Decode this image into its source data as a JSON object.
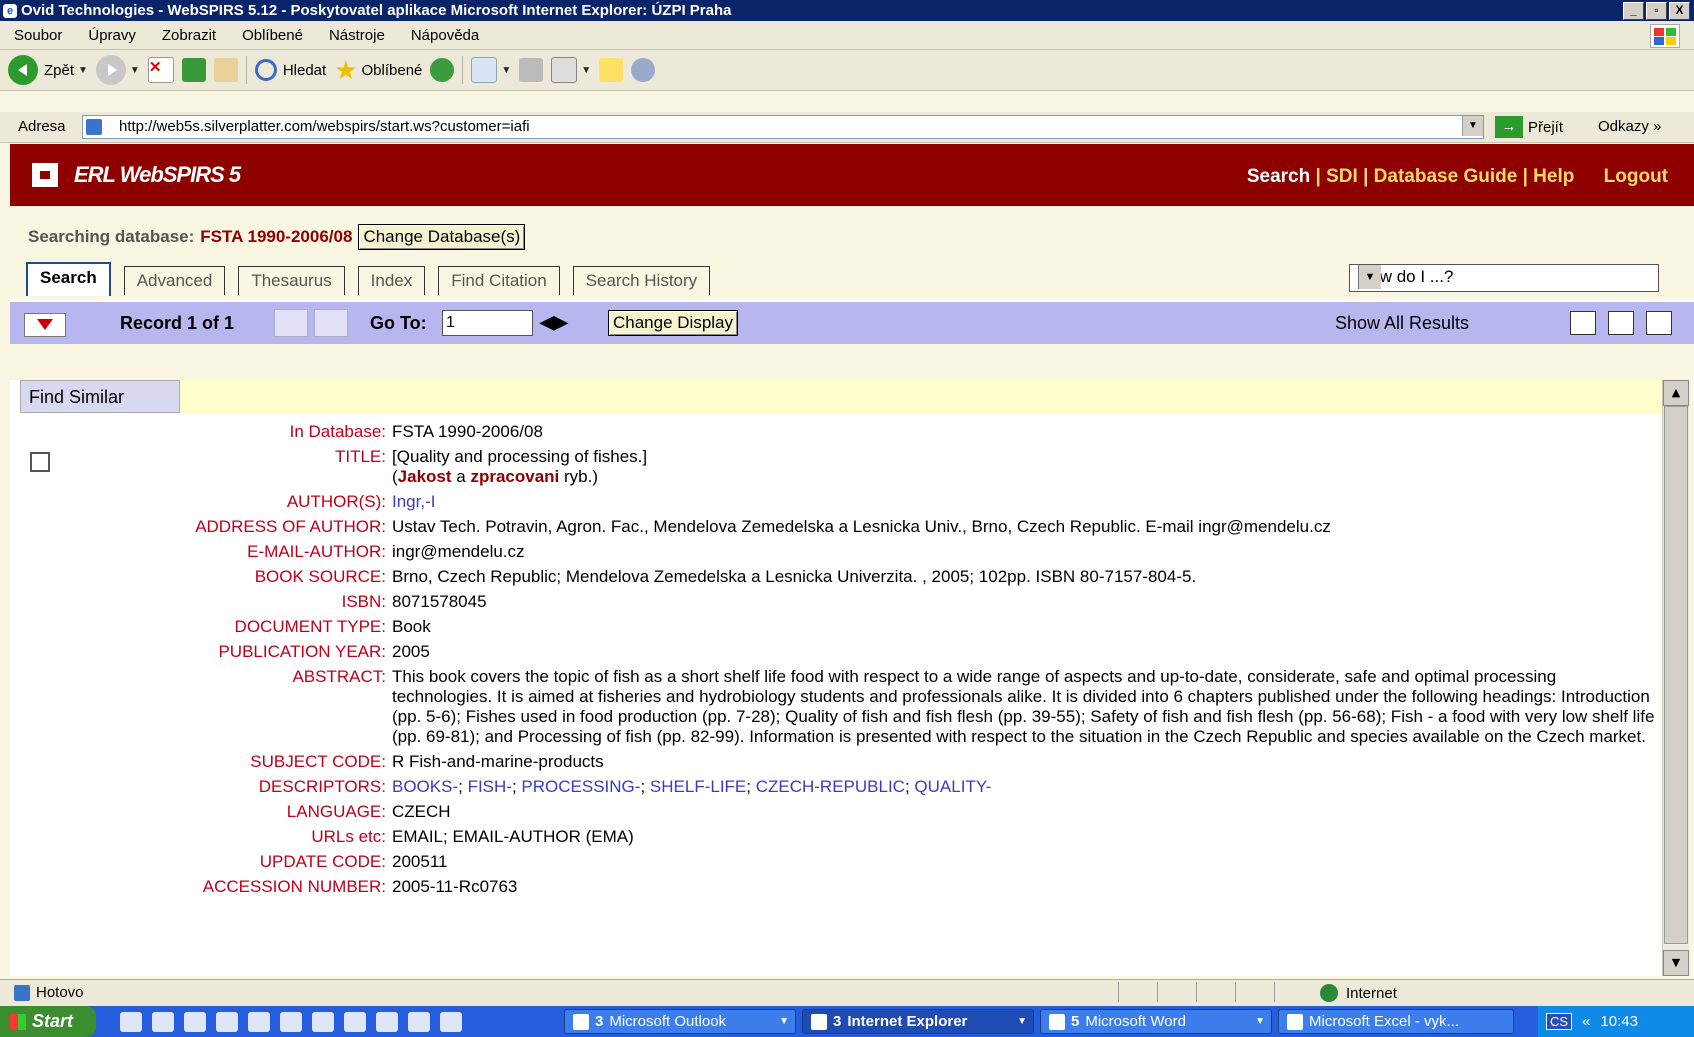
{
  "window": {
    "title": "Ovid Technologies - WebSPIRS 5.12 - Poskytovatel aplikace Microsoft Internet Explorer: ÚZPI Praha",
    "controls": [
      "_",
      "▫",
      "X"
    ]
  },
  "menu": [
    "Soubor",
    "Úpravy",
    "Zobrazit",
    "Oblíbené",
    "Nástroje",
    "Nápověda"
  ],
  "toolbar": {
    "back_label": "Zpět",
    "search_label": "Hledat",
    "favorites_label": "Oblíbené"
  },
  "address": {
    "label": "Adresa",
    "url": "http://web5s.silverplatter.com/webspirs/start.ws?customer=iafi",
    "go_label": "Přejít",
    "links_label": "Odkazy"
  },
  "app": {
    "logo": "ERL WebSPIRS 5",
    "nav": [
      "Search",
      "SDI",
      "Database Guide",
      "Help",
      "Logout"
    ],
    "searching_label": "Searching database:",
    "database": "FSTA 1990-2006/08",
    "change_db_label": "Change Database(s)",
    "tabs": [
      "Search",
      "Advanced",
      "Thesaurus",
      "Index",
      "Find Citation",
      "Search History"
    ],
    "active_tab": "Search",
    "howdo": "How do I ...?"
  },
  "record_bar": {
    "record_text": "Record 1 of 1",
    "goto_label": "Go To:",
    "goto_value": "1",
    "change_display_label": "Change Display",
    "show_all_label": "Show All Results"
  },
  "record": {
    "find_similar_label": "Find Similar",
    "fields": [
      {
        "label": "In Database:",
        "value": "FSTA 1990-2006/08"
      },
      {
        "label": "TITLE:",
        "value": "[Quality and processing of fishes.]"
      },
      {
        "label": "AUTHOR(S):",
        "value": "Ingr,-I"
      },
      {
        "label": "ADDRESS OF AUTHOR:",
        "value": "Ustav Tech. Potravin, Agron. Fac., Mendelova Zemedelska a Lesnicka Univ., Brno, Czech Republic. E-mail ingr@mendelu.cz"
      },
      {
        "label": "E-MAIL-AUTHOR:",
        "value": "ingr@mendelu.cz"
      },
      {
        "label": "BOOK SOURCE:",
        "value": "Brno, Czech Republic; Mendelova Zemedelska a Lesnicka Univerzita. , 2005; 102pp. ISBN 80-7157-804-5."
      },
      {
        "label": "ISBN:",
        "value": "8071578045"
      },
      {
        "label": "DOCUMENT TYPE:",
        "value": "Book"
      },
      {
        "label": "PUBLICATION YEAR:",
        "value": "2005"
      },
      {
        "label": "ABSTRACT:",
        "value": "This book covers the topic of fish as a short shelf life food with respect to a wide range of aspects and up-to-date, considerate, safe and optimal processing technologies. It is aimed at fisheries and hydrobiology students and professionals alike. It is divided into 6 chapters published under the following headings: Introduction (pp. 5-6); Fishes used in food production (pp. 7-28); Quality of fish and fish flesh (pp. 39-55); Safety of fish and fish flesh (pp. 56-68); Fish - a food with very low shelf life (pp. 69-81); and Processing of fish (pp. 82-99). Information is presented with respect to the situation in the Czech Republic and species available on the Czech market."
      },
      {
        "label": "SUBJECT CODE:",
        "value": "R Fish-and-marine-products"
      },
      {
        "label": "DESCRIPTORS:",
        "value": ""
      },
      {
        "label": "LANGUAGE:",
        "value": "CZECH"
      },
      {
        "label": "URLs etc:",
        "value": "EMAIL; EMAIL-AUTHOR (EMA)"
      },
      {
        "label": "UPDATE CODE:",
        "value": "200511"
      },
      {
        "label": "ACCESSION NUMBER:",
        "value": "2005-11-Rc0763"
      }
    ],
    "title_czech_open": "(",
    "title_czech_bold1": "Jakost",
    "title_czech_mid": " a ",
    "title_czech_bold2": "zpracovani",
    "title_czech_rest": " ryb.)",
    "descriptors": [
      "BOOKS-",
      "FISH-",
      "PROCESSING-",
      "SHELF-LIFE",
      "CZECH-REPUBLIC",
      "QUALITY-"
    ]
  },
  "status": {
    "text": "Hotovo",
    "zone": "Internet"
  },
  "taskbar": {
    "start": "Start",
    "tasks": [
      {
        "count": "3",
        "label": "Microsoft Outlook"
      },
      {
        "count": "3",
        "label": "Internet Explorer"
      },
      {
        "count": "5",
        "label": "Microsoft Word"
      },
      {
        "count": "",
        "label": "Microsoft Excel - vyk..."
      }
    ],
    "lang": "CS",
    "clock": "10:43"
  },
  "colors": {
    "header_bg": "#8E0000",
    "accent_gold": "#FFD86A",
    "label_red": "#C0001A",
    "link_blue": "#3A3AC8",
    "record_bar": "#B8B6EF",
    "page_bg": "#F9F6E1"
  }
}
